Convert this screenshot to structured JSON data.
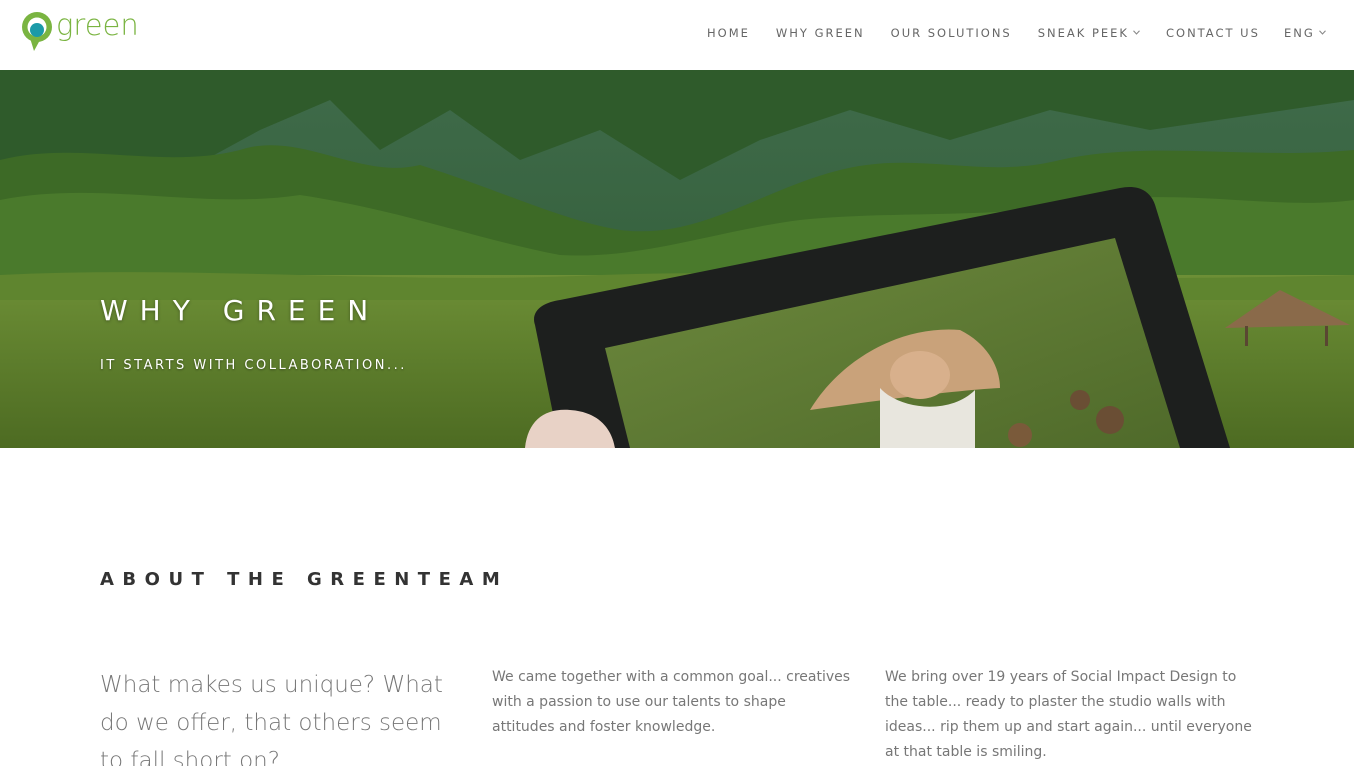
{
  "brand": {
    "name": "green",
    "colors": {
      "green": "#7ab441",
      "teal": "#1b9aa8"
    }
  },
  "nav": {
    "items": [
      {
        "label": "HOME",
        "has_dropdown": false
      },
      {
        "label": "WHY GREEN",
        "has_dropdown": false
      },
      {
        "label": "OUR SOLUTIONS",
        "has_dropdown": false
      },
      {
        "label": "SNEAK PEEK",
        "has_dropdown": true
      },
      {
        "label": "CONTACT US",
        "has_dropdown": false
      }
    ],
    "language": "ENG",
    "dropdown_icon": "chevron-down-icon"
  },
  "hero": {
    "title": "WHY GREEN",
    "subtitle": "IT STARTS WITH COLLABORATION..."
  },
  "about": {
    "title": "ABOUT THE GREENTEAM",
    "lead": "What makes us unique? What do we offer, that others seem to fall short on?",
    "col2": "We came together with a common goal... creatives with a passion to use our talents to shape attitudes and foster knowledge.",
    "col3": "We bring over 19 years of Social Impact Design to the table... ready to plaster the studio walls with ideas... rip them up and start again... until everyone at that table is smiling."
  }
}
